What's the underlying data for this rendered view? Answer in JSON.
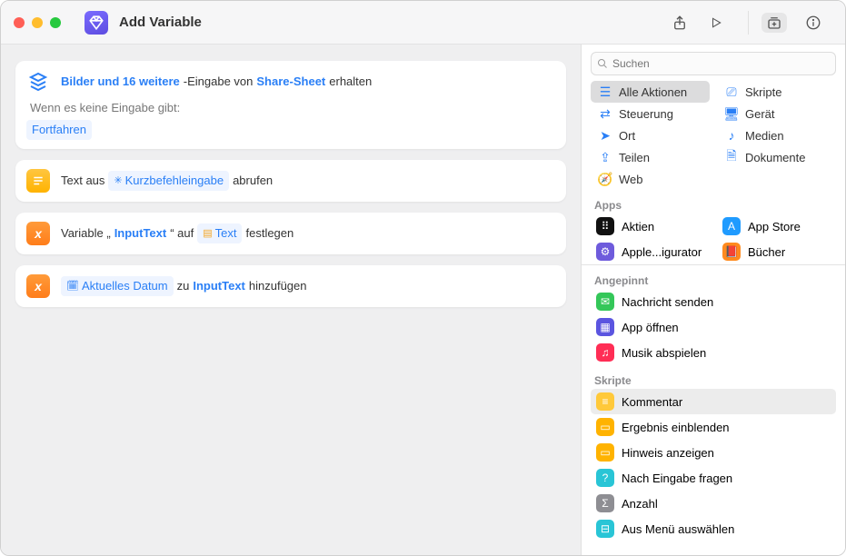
{
  "window": {
    "title": "Add Variable"
  },
  "search": {
    "placeholder": "Suchen"
  },
  "categories": [
    {
      "label": "Alle Aktionen",
      "icon": "list",
      "selected": true
    },
    {
      "label": "Skripte",
      "icon": "script"
    },
    {
      "label": "Steuerung",
      "icon": "control"
    },
    {
      "label": "Gerät",
      "icon": "device"
    },
    {
      "label": "Ort",
      "icon": "location"
    },
    {
      "label": "Medien",
      "icon": "media"
    },
    {
      "label": "Teilen",
      "icon": "share"
    },
    {
      "label": "Dokumente",
      "icon": "doc"
    },
    {
      "label": "Web",
      "icon": "web"
    }
  ],
  "apps_label": "Apps",
  "apps": [
    {
      "label": "Aktien",
      "color": "#111"
    },
    {
      "label": "App Store",
      "color": "#1f9bff"
    },
    {
      "label": "Apple...igurator",
      "color": "#6e5bdc"
    },
    {
      "label": "Bücher",
      "color": "#ff8a1e"
    }
  ],
  "pinned_label": "Angepinnt",
  "pinned": [
    {
      "label": "Nachricht senden",
      "color": "#34c759"
    },
    {
      "label": "App öffnen",
      "color": "#5b55e0"
    },
    {
      "label": "Musik abspielen",
      "color": "#ff2d55"
    }
  ],
  "scripts_label": "Skripte",
  "scripts": [
    {
      "label": "Kommentar",
      "color": "#ffc93a",
      "selected": true
    },
    {
      "label": "Ergebnis einblenden",
      "color": "#ffb300"
    },
    {
      "label": "Hinweis anzeigen",
      "color": "#ffb300"
    },
    {
      "label": "Nach Eingabe fragen",
      "color": "#29c5d6"
    },
    {
      "label": "Anzahl",
      "color": "#8e8e93"
    },
    {
      "label": "Aus Menü auswählen",
      "color": "#29c5d6"
    }
  ],
  "card1": {
    "t0": "Bilder und 16 weitere",
    "t1": "-Eingabe von",
    "t2": "Share-Sheet",
    "t3": "erhalten",
    "noinput": "Wenn es keine Eingabe gibt:",
    "fallback": "Fortfahren"
  },
  "card2": {
    "t0": "Text aus",
    "token": "Kurzbefehleingabe",
    "t1": "abrufen"
  },
  "card3": {
    "t0": "Variable „",
    "var": "InputText",
    "t1": "“ auf",
    "val": "Text",
    "t2": "festlegen"
  },
  "card4": {
    "date": "Aktuelles Datum",
    "t0": "zu",
    "var": "InputText",
    "t1": "hinzufügen"
  }
}
